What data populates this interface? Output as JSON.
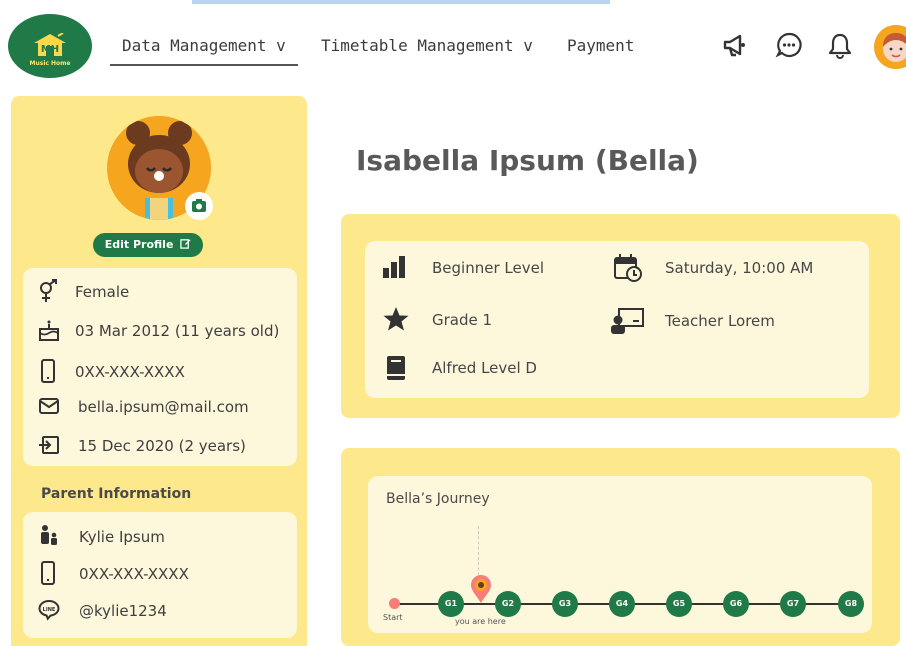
{
  "header": {
    "logo_text": "MH",
    "logo_subtitle": "Music Home",
    "nav": [
      "Data Management v",
      "Timetable Management v",
      "Payment"
    ],
    "icons": [
      "megaphone-icon",
      "chat-icon",
      "bell-icon",
      "user-avatar"
    ]
  },
  "profile": {
    "name": "Isabella Ipsum (Bella)",
    "edit_label": "Edit Profile",
    "gender": "Female",
    "birthdate": "03 Mar 2012 (11 years old)",
    "phone": "0XX-XXX-XXXX",
    "email": "bella.ipsum@mail.com",
    "joined": "15 Dec 2020 (2 years)"
  },
  "parent": {
    "title": "Parent Information",
    "name": "Kylie Ipsum",
    "phone": "0XX-XXX-XXXX",
    "line_id": "@kylie1234"
  },
  "details": {
    "level": "Beginner Level",
    "grade": "Grade 1",
    "book": "Alfred Level D",
    "schedule": "Saturday, 10:00 AM",
    "teacher": "Teacher Lorem"
  },
  "journey": {
    "title": "Bella’s Journey",
    "start_label": "Start",
    "current_label": "you are here",
    "nodes": [
      "G1",
      "G2",
      "G3",
      "G4",
      "G5",
      "G6",
      "G7",
      "G8"
    ]
  },
  "colors": {
    "primary_green": "#1f7a47",
    "panel_yellow": "#fde98b",
    "card_cream": "#fdf7dc",
    "start_red": "#f67d78"
  }
}
